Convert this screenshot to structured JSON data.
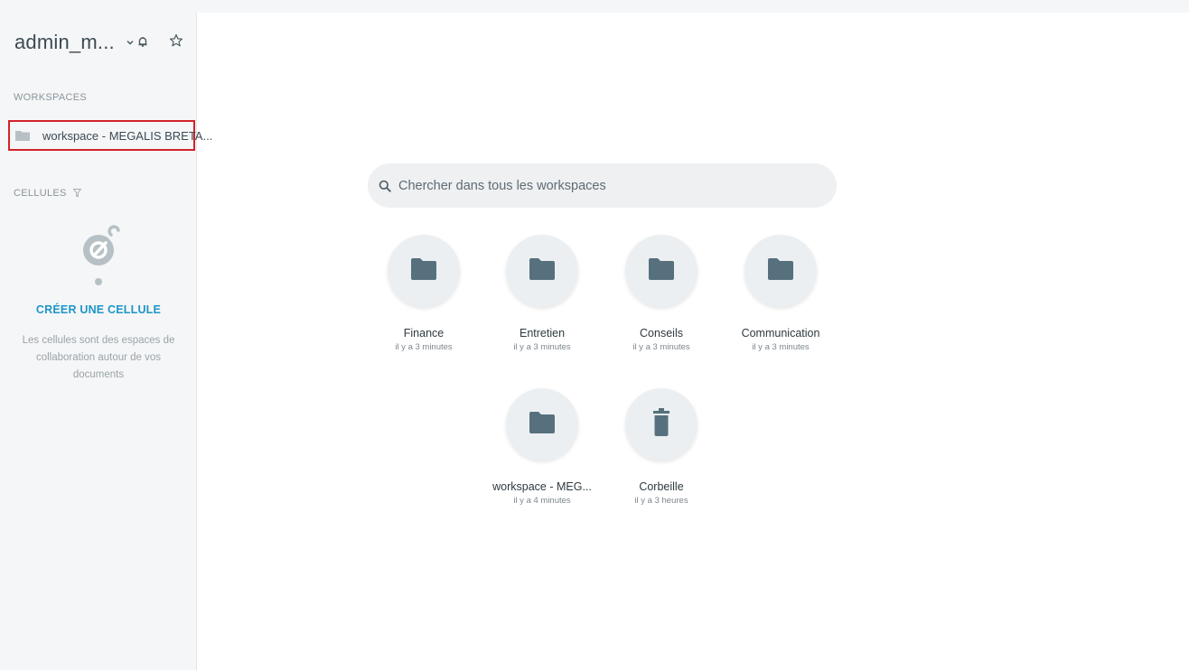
{
  "user": {
    "name": "admin_m..."
  },
  "sidebar": {
    "workspaces_label": "WORKSPACES",
    "workspace_item": "workspace - MEGALIS BRETA...",
    "cells_label": "CELLULES",
    "create_cell": "CRÉER UNE CELLULE",
    "cells_description": "Les cellules sont des espaces de collaboration autour de vos documents"
  },
  "search": {
    "placeholder": "Chercher dans tous les workspaces"
  },
  "tiles": [
    {
      "name": "Finance",
      "time": "il y a 3 minutes",
      "icon": "folder-icon"
    },
    {
      "name": "Entretien",
      "time": "il y a 3 minutes",
      "icon": "folder-icon"
    },
    {
      "name": "Conseils",
      "time": "il y a 3 minutes",
      "icon": "folder-icon"
    },
    {
      "name": "Communication",
      "time": "il y a 3 minutes",
      "icon": "folder-icon"
    },
    {
      "name": "workspace - MEG...",
      "time": "il y a 4 minutes",
      "icon": "folder-icon"
    },
    {
      "name": "Corbeille",
      "time": "il y a 3 heures",
      "icon": "trash-icon"
    }
  ],
  "colors": {
    "accent": "#1e96c8",
    "selection_border": "#d1232a",
    "icon_slate": "#56707e",
    "sidebar_bg": "#f5f6f7"
  }
}
